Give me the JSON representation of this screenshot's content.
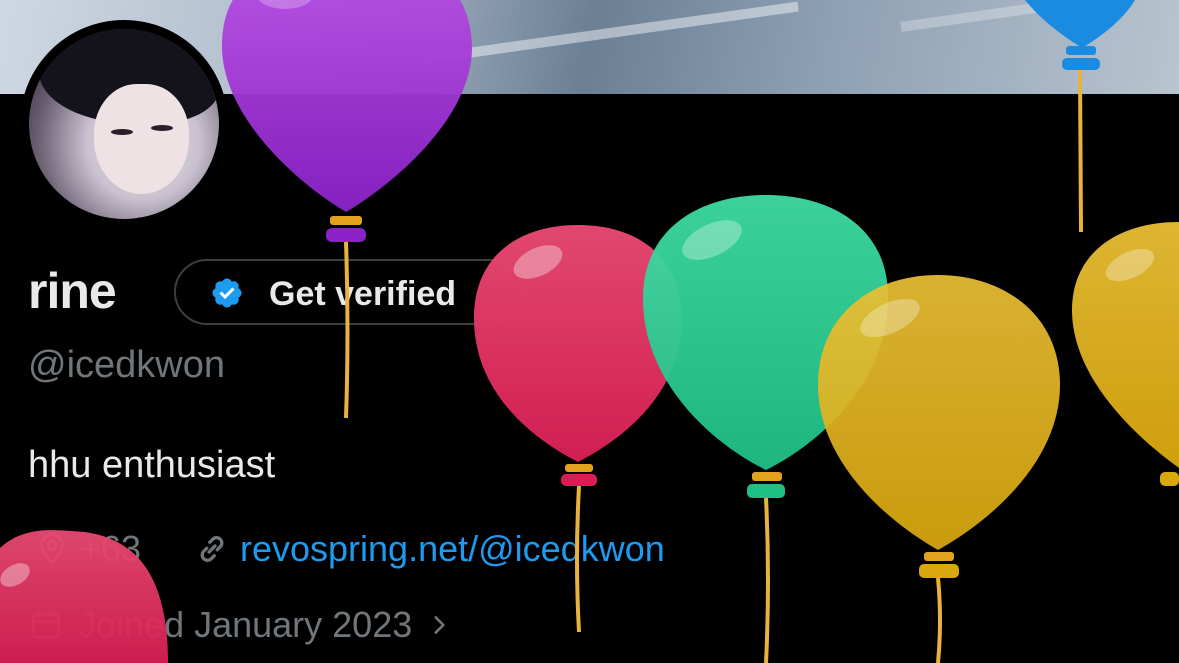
{
  "profile": {
    "display_name": "rine",
    "handle": "@icedkwon",
    "bio": "hhu enthusiast",
    "location": "+63",
    "website": "revospring.net/@icedkwon",
    "joined": "Joined January 2023"
  },
  "buttons": {
    "get_verified_label": "Get verified"
  },
  "icons": {
    "verified_badge": "verified-badge-icon",
    "location": "location-pin-icon",
    "link": "link-icon",
    "calendar": "calendar-icon",
    "chevron": "chevron-right-icon"
  },
  "colors": {
    "background": "#000000",
    "primary_text": "#e7e9ea",
    "secondary_text": "#71767b",
    "link": "#1d9bf0",
    "verified_blue": "#1d9bf0",
    "balloon_purple": "#9b2fd9",
    "balloon_red": "#e23565",
    "balloon_green": "#2fcf94",
    "balloon_yellow": "#e2b21f",
    "balloon_blue": "#1a8be0"
  }
}
